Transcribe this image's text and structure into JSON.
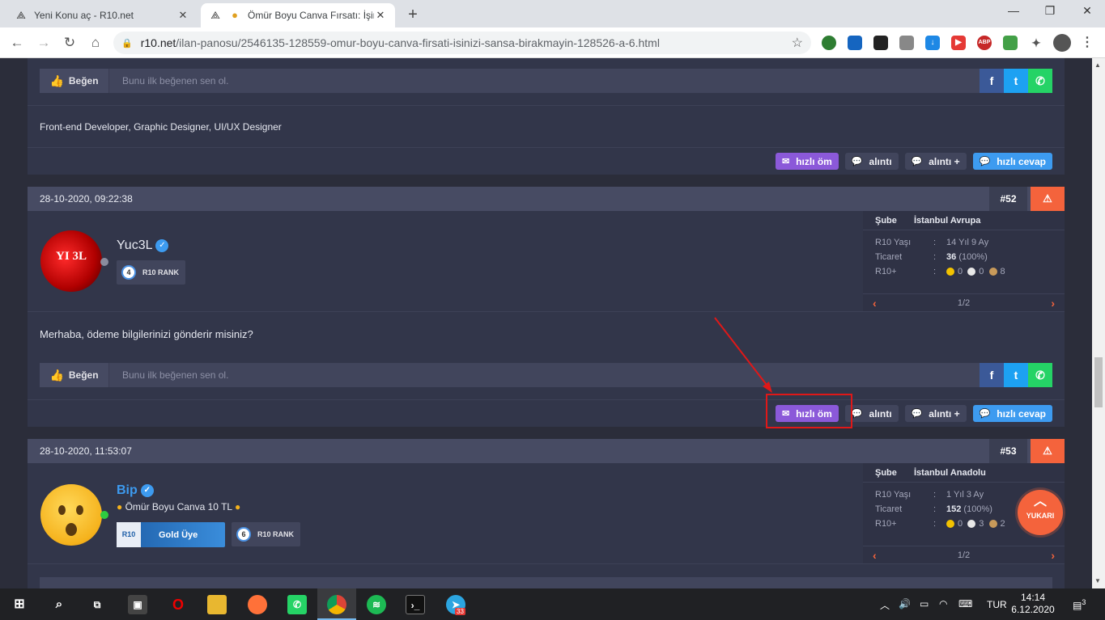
{
  "browser": {
    "tabs": [
      {
        "title": "Yeni Konu aç - R10.net"
      },
      {
        "title": "Ömür Boyu Canva Fırsatı: İşinizi Sansa"
      }
    ],
    "url_host": "r10.net",
    "url_path": "/ilan-panosu/2546135-128559-omur-boyu-canva-firsati-isinizi-sansa-birakmayin-128526-a-6.html",
    "abp_label": "ABP"
  },
  "post51": {
    "like_label": "Beğen",
    "like_text": "Bunu ilk beğenen sen ol.",
    "signature": "Front-end Developer, Graphic Designer, UI/UX Designer",
    "actions": [
      "hızlı öm",
      "alıntı",
      "alıntı +",
      "hızlı cevap"
    ]
  },
  "post52": {
    "date": "28-10-2020, 09:22:38",
    "number": "#52",
    "username": "Yuc3L",
    "rank_num": "4",
    "rank_label": "R10 RANK",
    "avatar_text": "YI 3L",
    "info": {
      "branch_key": "Şube",
      "branch_val": "İstanbul Avrupa",
      "age_key": "R10 Yaşı",
      "age_val": "14 Yıl 9 Ay",
      "trade_key": "Ticaret",
      "trade_num": "36",
      "trade_pct": "(100%)",
      "plus_key": "R10+",
      "medals": [
        "0",
        "0",
        "8"
      ],
      "colon": ":",
      "page": "1/2"
    },
    "message": "Merhaba, ödeme bilgilerinizi gönderir misiniz?",
    "like_label": "Beğen",
    "like_text": "Bunu ilk beğenen sen ol.",
    "actions": [
      "hızlı öm",
      "alıntı",
      "alıntı +",
      "hızlı cevap"
    ]
  },
  "post53": {
    "date": "28-10-2020, 11:53:07",
    "number": "#53",
    "username": "Bip",
    "tagline": "Ömür Boyu Canva 10 TL",
    "badge_prefix": "R10",
    "badge": "Gold Üye",
    "rank_num": "6",
    "rank_label": "R10 RANK",
    "info": {
      "branch_key": "Şube",
      "branch_val": "İstanbul Anadolu",
      "age_key": "R10 Yaşı",
      "age_val": "1 Yıl 3 Ay",
      "trade_key": "Ticaret",
      "trade_num": "152",
      "trade_pct": "(100%)",
      "plus_key": "R10+",
      "medals": [
        "0",
        "3",
        "2"
      ],
      "colon": ":",
      "page": "1/2"
    }
  },
  "scroll_top": {
    "label": "YUKARI"
  },
  "taskbar": {
    "lang": "TUR",
    "time": "14:14",
    "date": "6.12.2020",
    "notif_count": "3",
    "telegram_badge": "33"
  },
  "colors": {
    "page_bg": "#2b2d3a",
    "card_bg": "#32364a",
    "accent_orange": "#f4633c",
    "purple": "#8b59d9",
    "blue": "#3d9bf0",
    "annotation_red": "#e01818"
  },
  "icons": [
    "thumbs-up-icon",
    "facebook-icon",
    "twitter-icon",
    "whatsapp-icon",
    "envelope-icon",
    "comment-icon",
    "comments-icon",
    "warning-icon",
    "verified-icon",
    "chevron-left-icon",
    "chevron-right-icon",
    "chevron-up-icon"
  ]
}
